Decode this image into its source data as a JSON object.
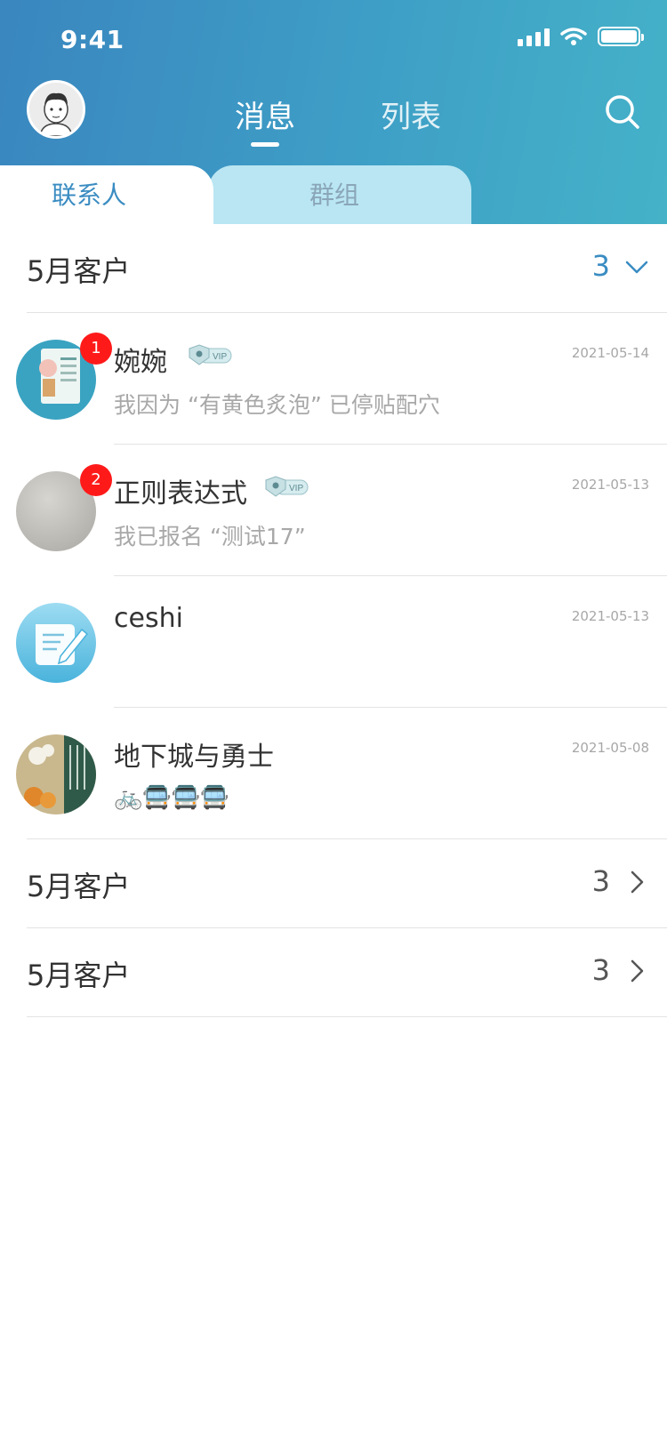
{
  "status": {
    "time": "9:41"
  },
  "header": {
    "tabs": [
      {
        "label": "消息",
        "active": true
      },
      {
        "label": "列表",
        "active": false
      }
    ]
  },
  "subtabs": [
    {
      "label": "联系人",
      "active": true
    },
    {
      "label": "群组",
      "active": false
    }
  ],
  "groups": [
    {
      "title": "5月客户",
      "count": "3",
      "expanded": true
    },
    {
      "title": "5月客户",
      "count": "3",
      "expanded": false
    },
    {
      "title": "5月客户",
      "count": "3",
      "expanded": false
    }
  ],
  "contacts": [
    {
      "name": "婉婉",
      "vip": "VIP",
      "date": "2021-05-14",
      "preview": "我因为 “有黄色炙泡” 已停贴配穴",
      "badge": "1",
      "avatar_color": "#3aa3c1"
    },
    {
      "name": "正则表达式",
      "vip": "VIP",
      "date": "2021-05-13",
      "preview": "我已报名 “测试17”",
      "badge": "2",
      "avatar_color": "#bdbbb5"
    },
    {
      "name": "ceshi",
      "date": "2021-05-13",
      "preview": "",
      "avatar_color": "#69c2e2"
    },
    {
      "name": "地下城与勇士",
      "date": "2021-05-08",
      "preview": "🚲🚍🚍🚍",
      "avatar_color": "#7b8f6d"
    }
  ],
  "colors": {
    "accent": "#3a8cc2",
    "badge": "#ff1a1a",
    "header_start": "#3a86bf",
    "header_end": "#45b2c8"
  }
}
